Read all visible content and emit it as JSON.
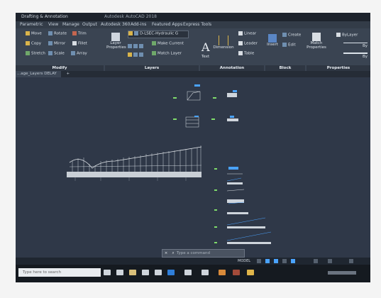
{
  "window": {
    "app_title": "Drafting & Annotation",
    "file_title": "Autodesk AutoCAD 2018"
  },
  "menu_tabs": [
    "Parametric",
    "View",
    "Manage",
    "Output",
    "Autodesk 360",
    "Add-ins",
    "Featured Apps",
    "Express Tools"
  ],
  "ribbon": {
    "modify": {
      "move": "Move",
      "rotate": "Rotate",
      "trim": "Trim",
      "copy": "Copy",
      "mirror": "Mirror",
      "fillet": "Fillet",
      "stretch": "Stretch",
      "scale": "Scale",
      "array": "Array",
      "panel": "Modify"
    },
    "layers": {
      "layer_props": "Layer",
      "layer_props2": "Properties",
      "current_layer": "D-LSEC-Hydraulic G",
      "make_current": "Make Current",
      "match_layer": "Match Layer",
      "panel": "Layers"
    },
    "annotation": {
      "text": "Text",
      "dimension": "Dimension",
      "linear": "Linear",
      "leader": "Leader",
      "table": "Table",
      "panel": "Annotation"
    },
    "block": {
      "insert": "Insert",
      "create": "Create",
      "edit": "Edit",
      "panel": "Block"
    },
    "properties": {
      "match": "Match",
      "match2": "Properties",
      "bylayer": "ByLayer",
      "bylayer_short": "By",
      "panel": "Properties"
    }
  },
  "file_tab": "...age_Layers DELAY",
  "command_line": {
    "placeholder": "Type a command"
  },
  "status": {
    "model": "MODEL"
  },
  "taskbar": {
    "search": "Type here to search"
  },
  "colors": {
    "accent": "#7fdc6b",
    "ribbon": "#3a4452",
    "canvas": "#2f3848"
  }
}
